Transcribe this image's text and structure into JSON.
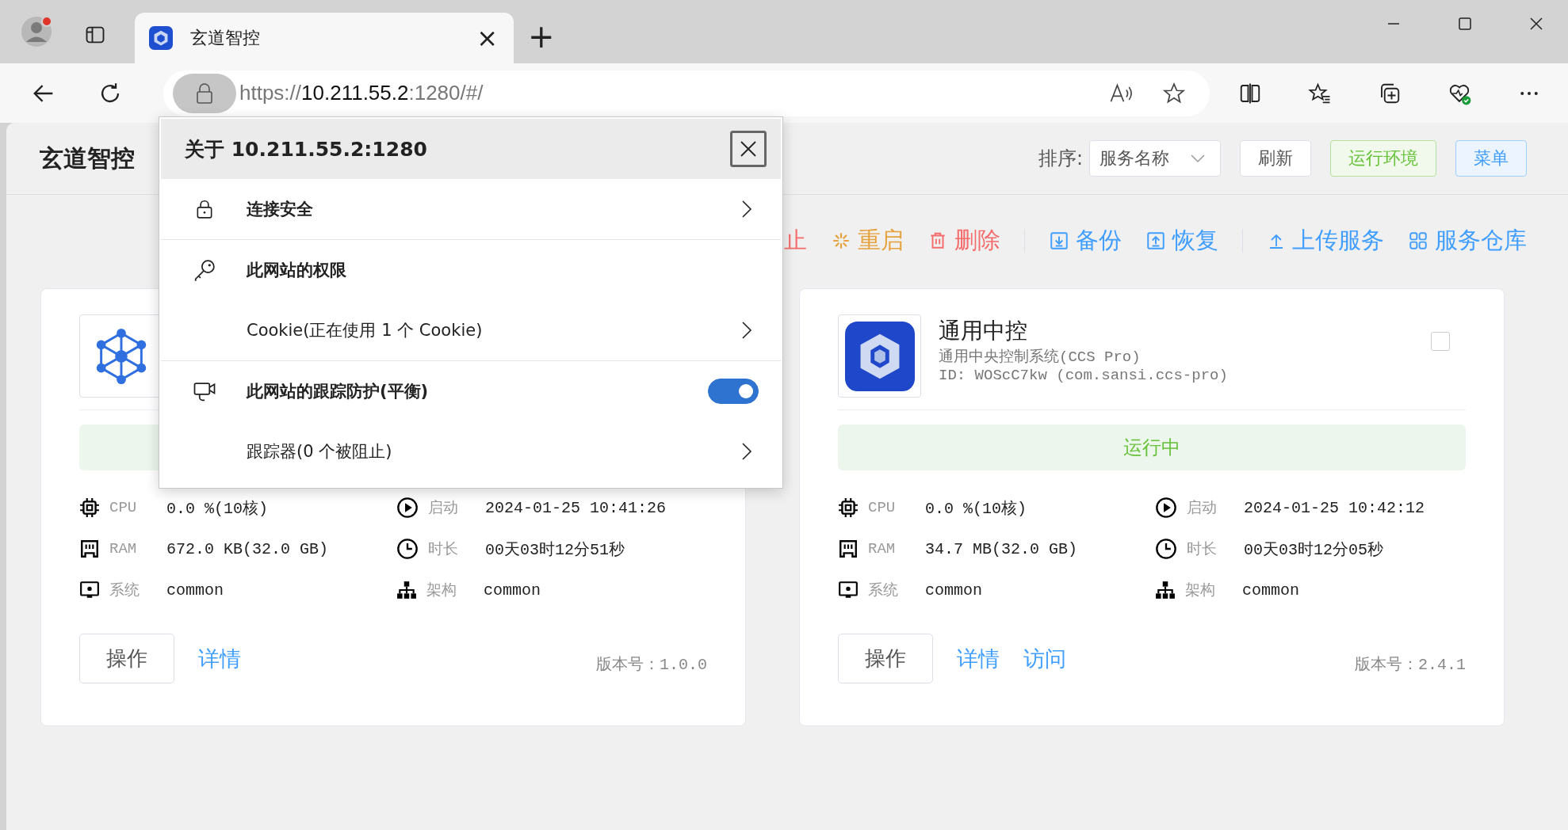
{
  "browser": {
    "tab": {
      "title": "玄道智控",
      "close": "×",
      "selected": true
    },
    "new_tab": "+",
    "url": {
      "scheme": "https://",
      "host": "10.211.55.2",
      "rest": ":1280/#/"
    }
  },
  "site_info": {
    "title": "关于 10.211.55.2:1280",
    "sections": [
      {
        "rows": [
          {
            "kind": "heading",
            "label": "连接安全",
            "chevron": true
          }
        ]
      },
      {
        "rows": [
          {
            "kind": "heading",
            "label": "此网站的权限",
            "chevron": false
          },
          {
            "kind": "sub",
            "label": "Cookie(正在使用 1 个 Cookie)",
            "chevron": true
          }
        ]
      },
      {
        "rows": [
          {
            "kind": "heading",
            "label": "此网站的跟踪防护(平衡)",
            "chevron": false,
            "toggle_on": true
          },
          {
            "kind": "sub",
            "label": "跟踪器(0 个被阻止)",
            "chevron": true
          }
        ]
      }
    ]
  },
  "header": {
    "title": "玄道智控",
    "sort_label": "排序:",
    "sort_value": "服务名称",
    "buttons": [
      {
        "label": "刷新",
        "kind": "default"
      },
      {
        "label": "运行环境",
        "kind": "success"
      },
      {
        "label": "菜单",
        "kind": "primary"
      }
    ]
  },
  "action_groups": [
    [
      {
        "kind": "stop",
        "label": "止"
      },
      {
        "kind": "restart",
        "label": "重启"
      },
      {
        "kind": "delete",
        "label": "删除"
      }
    ],
    [
      {
        "kind": "backup",
        "label": "备份"
      },
      {
        "kind": "restore",
        "label": "恢复"
      }
    ],
    [
      {
        "kind": "upload",
        "label": "上传服务"
      },
      {
        "kind": "store",
        "label": "服务仓库"
      }
    ]
  ],
  "services": [
    {
      "status": {
        "kind": "running"
      },
      "stats": [
        {
          "kind": "cpu",
          "label": "CPU",
          "value": "0.0 %(10核)"
        },
        {
          "kind": "start",
          "label": "启动",
          "value": "2024-01-25 10:41:26"
        },
        {
          "kind": "ram",
          "label": "RAM",
          "value": "672.0 KB(32.0 GB)"
        },
        {
          "kind": "duration",
          "label": "时长",
          "value": "00天03时12分51秒"
        },
        {
          "kind": "system",
          "label": "系统",
          "value": "common"
        },
        {
          "kind": "arch",
          "label": "架构",
          "value": "common"
        }
      ],
      "button": "操作",
      "links": [
        "详情"
      ],
      "version": "版本号：1.0.0"
    },
    {
      "name": "通用中控",
      "subtitle": "通用中央控制系统(CCS Pro)",
      "id": "ID: WOScC7kw (com.sansi.ccs-pro)",
      "checked": false,
      "status": {
        "kind": "running",
        "label": "运行中"
      },
      "stats": [
        {
          "kind": "cpu",
          "label": "CPU",
          "value": "0.0 %(10核)"
        },
        {
          "kind": "start",
          "label": "启动",
          "value": "2024-01-25 10:42:12"
        },
        {
          "kind": "ram",
          "label": "RAM",
          "value": "34.7 MB(32.0 GB)"
        },
        {
          "kind": "duration",
          "label": "时长",
          "value": "00天03时12分05秒"
        },
        {
          "kind": "system",
          "label": "系统",
          "value": "common"
        },
        {
          "kind": "arch",
          "label": "架构",
          "value": "common"
        }
      ],
      "button": "操作",
      "links": [
        "详情",
        "访问"
      ],
      "version": "版本号：2.4.1"
    }
  ]
}
